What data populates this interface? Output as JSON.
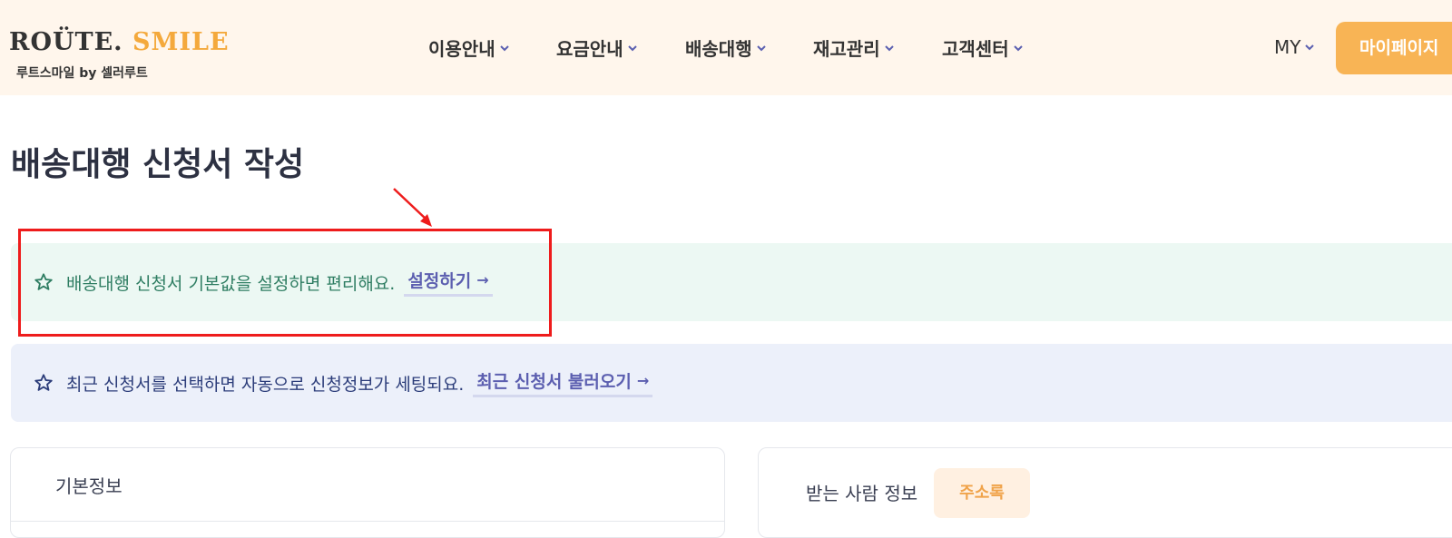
{
  "header": {
    "logo": {
      "route": "ROÜTE.",
      "smile": "SMILE",
      "subtitle": "루트스마일 by 셀러루트"
    },
    "nav": [
      {
        "label": "이용안내"
      },
      {
        "label": "요금안내"
      },
      {
        "label": "배송대행"
      },
      {
        "label": "재고관리"
      },
      {
        "label": "고객센터"
      }
    ],
    "my_label": "MY",
    "mypage_button": "마이페이지"
  },
  "page_title": "배송대행 신청서 작성",
  "banners": {
    "defaults": {
      "message": "배송대행 신청서 기본값을 설정하면 편리해요.",
      "link": "설정하기"
    },
    "recent": {
      "message": "최근 신청서를 선택하면 자동으로 신청정보가 세팅되요.",
      "link": "최근 신청서 불러오기"
    }
  },
  "cards": {
    "basic_info_title": "기본정보",
    "recipient_title": "받는 사람 정보",
    "address_book_button": "주소록"
  },
  "colors": {
    "header_bg": "#fff6ec",
    "brand_orange": "#f8b455",
    "link_purple": "#5c5fb0",
    "banner_green_bg": "#ecf8f3",
    "banner_blue_bg": "#ecf0fa",
    "annotation_red": "#ee1c1c"
  }
}
